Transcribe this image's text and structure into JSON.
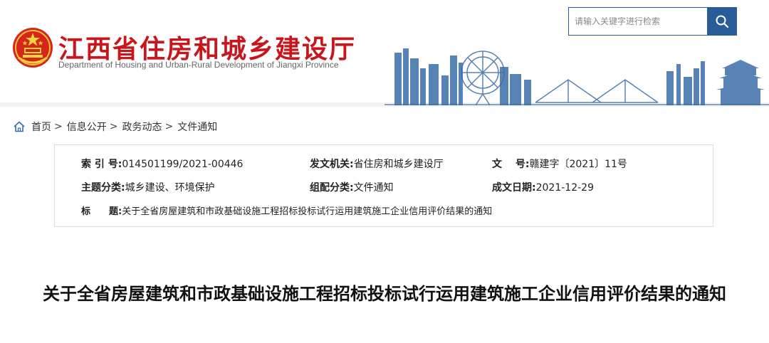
{
  "site": {
    "title": "江西省住房和城乡建设厅",
    "subtitle": "Department of Housing and Urban-Rural Development of Jiangxi Province",
    "brand_color": "#c8161d",
    "accent_color": "#2a5c9a"
  },
  "search": {
    "placeholder": "请输入关键字进行检索",
    "button_icon": "search-icon"
  },
  "breadcrumb": {
    "home_icon": "home-icon",
    "items": [
      "首页",
      "信息公开",
      "政务动态",
      "文件通知"
    ],
    "separator": ">"
  },
  "meta": {
    "index_label": "索 引 号:",
    "index_value": "014501199/2021-00446",
    "issuer_label": "发文机关:",
    "issuer_value": "省住房和城乡建设厅",
    "docno_label": "文　 号:",
    "docno_value": "赣建字〔2021〕11号",
    "topic_label": "主题分类:",
    "topic_value": "城乡建设、环境保护",
    "category_label": "组配分类:",
    "category_value": "文件通知",
    "date_label": "成文日期:",
    "date_value": "2021-12-29",
    "title_label": "标　　题:",
    "title_value": "关于全省房屋建筑和市政基础设施工程招标投标试行运用建筑施工企业信用评价结果的通知"
  },
  "article": {
    "title": "关于全省房屋建筑和市政基础设施工程招标投标试行运用建筑施工企业信用评价结果的通知"
  }
}
